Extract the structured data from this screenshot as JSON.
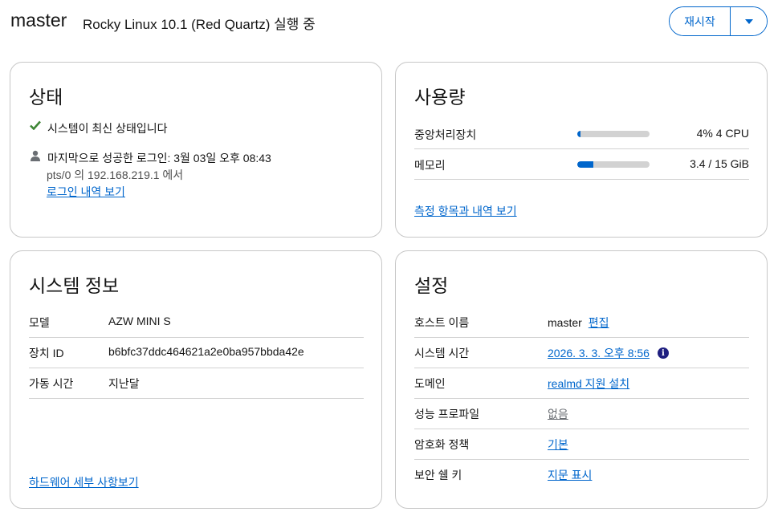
{
  "header": {
    "hostname": "master",
    "os_status": "Rocky Linux 10.1 (Red Quartz) 실행 중",
    "restart_label": "재시작",
    "restart_toggle_icon": "caret-down-icon"
  },
  "status_card": {
    "title": "상태",
    "update_status": "시스템이 최신 상태입니다",
    "update_icon": "check-icon",
    "last_login": "마지막으로 성공한 로그인: 3월 03일 오후 08:43",
    "login_icon": "user-icon",
    "login_from": "pts/0 의 192.168.219.1 에서",
    "login_history_link": "로그인 내역 보기"
  },
  "usage_card": {
    "title": "사용량",
    "rows": [
      {
        "label": "중앙처리장치",
        "value": "4% 4 CPU",
        "fraction": 0.04
      },
      {
        "label": "메모리",
        "value": "3.4 / 15 GiB",
        "fraction": 0.22
      }
    ],
    "metrics_link": "측정 항목과 내역 보기"
  },
  "sysinfo_card": {
    "title": "시스템 정보",
    "rows": [
      {
        "key": "모델",
        "value": "AZW MINI S"
      },
      {
        "key": "장치 ID",
        "value": "b6bfc37ddc464621a2e0ba957bbda42e"
      },
      {
        "key": "가동 시간",
        "value": "지난달"
      }
    ],
    "hardware_link": "하드웨어 세부 사항보기"
  },
  "config_card": {
    "title": "설정",
    "hostname_key": "호스트 이름",
    "hostname_value": "master",
    "hostname_edit": "편집",
    "systime_key": "시스템 시간",
    "systime_value": "2026. 3. 3. 오후 8:56",
    "systime_icon": "info-icon",
    "domain_key": "도메인",
    "domain_value": "realmd 지원 설치",
    "perf_key": "성능 프로파일",
    "perf_value": "없음",
    "crypto_key": "암호화 정책",
    "crypto_value": "기본",
    "ssh_key": "보안 쉘 키",
    "ssh_value": "지문 표시"
  },
  "colors": {
    "accent": "#0066cc",
    "success": "#3e8635",
    "border": "#c7c7c7"
  }
}
